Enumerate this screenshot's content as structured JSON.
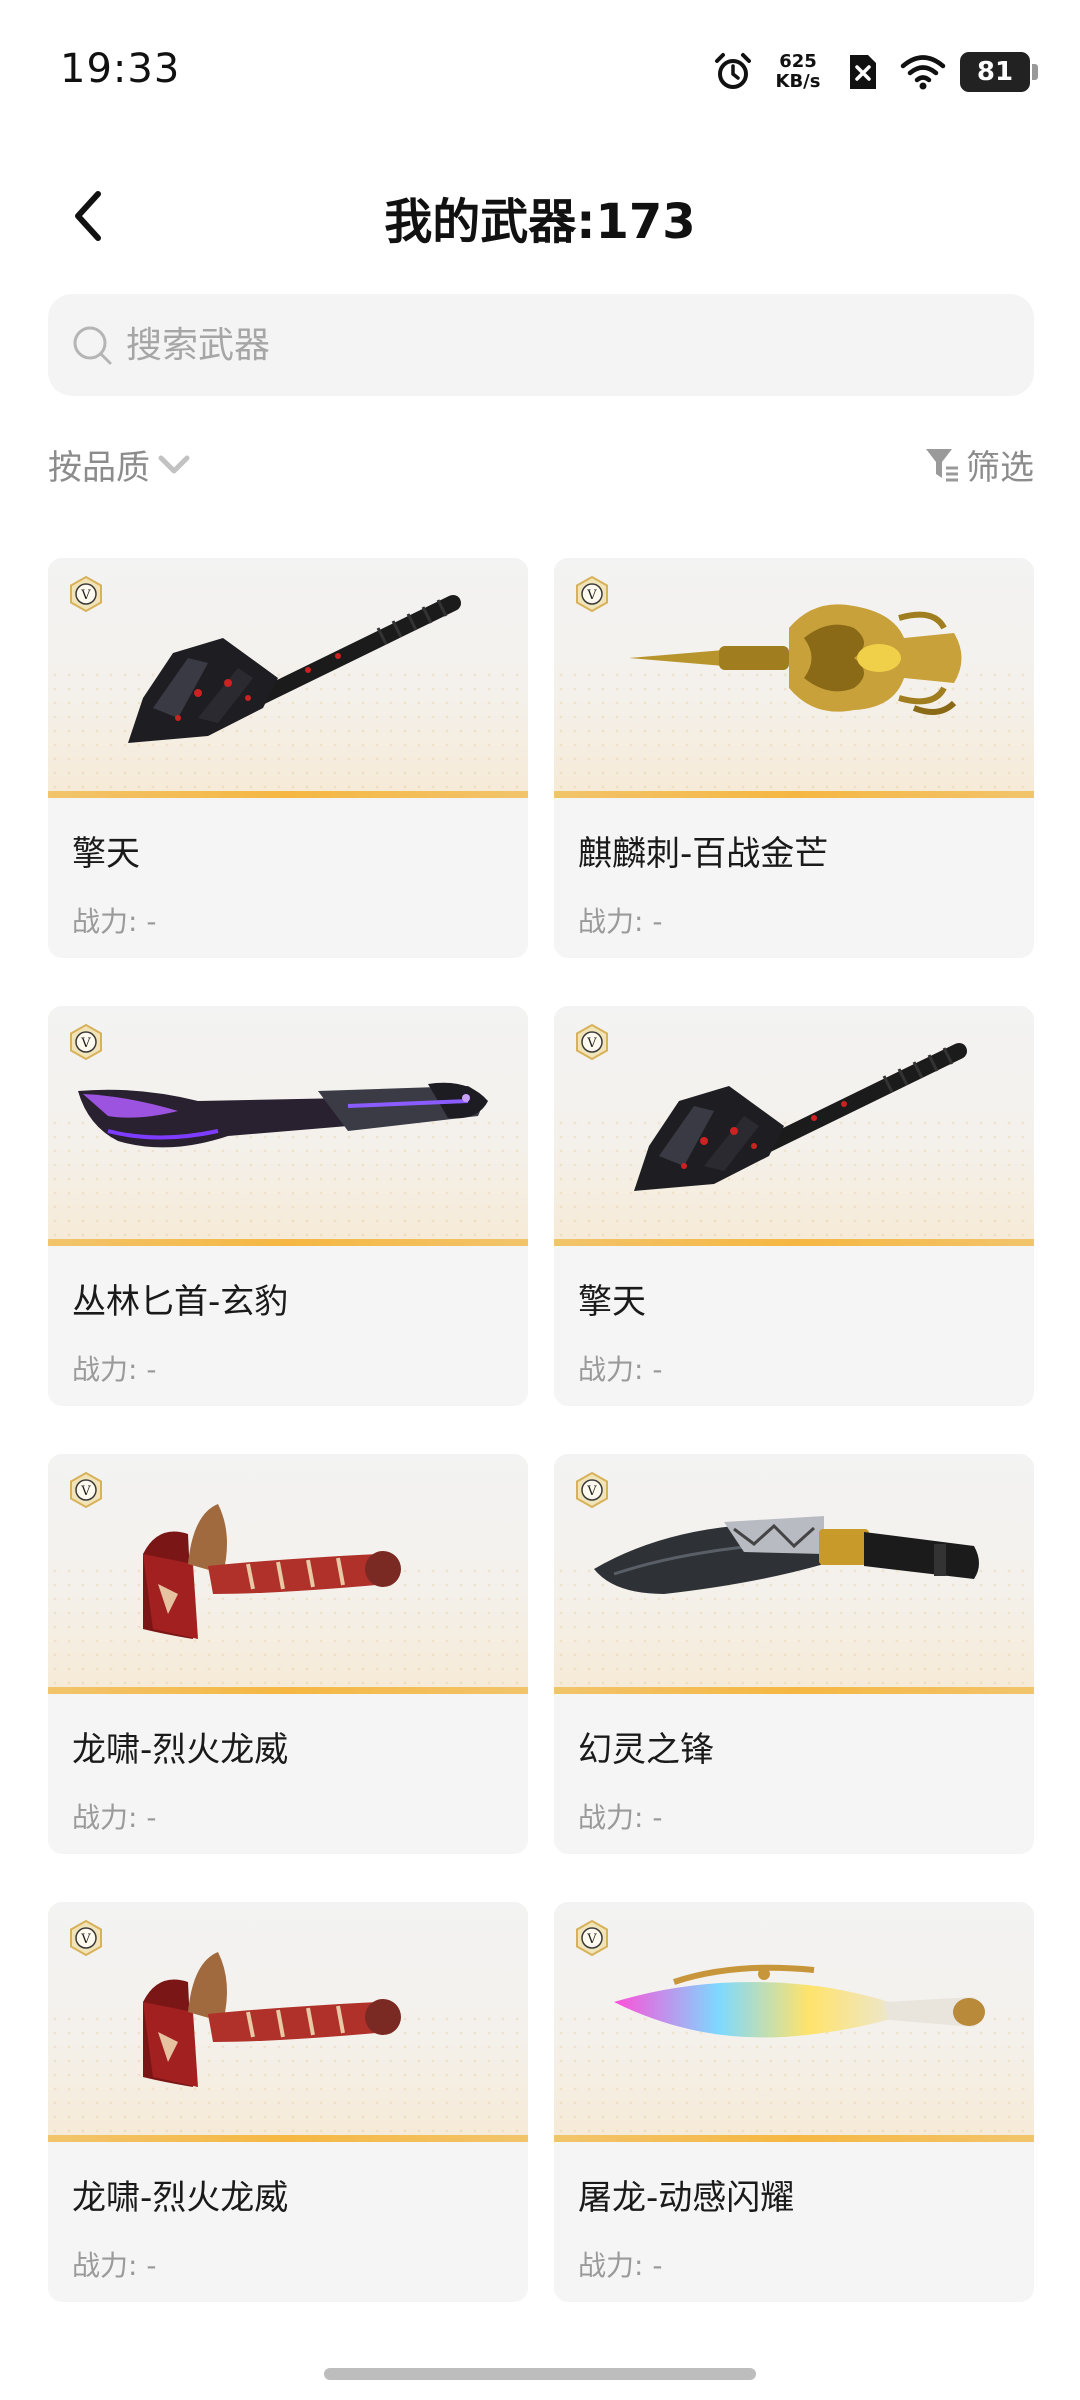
{
  "status_bar": {
    "time": "19:33",
    "net_speed_value": "625",
    "net_speed_unit": "KB/s",
    "battery": "81",
    "icons": [
      "alarm-icon",
      "no-sim-icon",
      "wifi-icon",
      "battery-icon"
    ]
  },
  "header": {
    "title": "我的武器:173",
    "back_icon": "chevron-left-icon"
  },
  "search": {
    "placeholder": "搜索武器",
    "value": ""
  },
  "sort": {
    "label": "按品质",
    "icon": "chevron-down-icon"
  },
  "filter": {
    "label": "筛选",
    "icon": "filter-icon"
  },
  "badge_letter": "V",
  "power_label": "战力: -",
  "weapons": [
    {
      "name": "擎天",
      "power": "战力: -",
      "kind": "spade"
    },
    {
      "name": "麒麟刺-百战金芒",
      "power": "战力: -",
      "kind": "golden-dagger"
    },
    {
      "name": "丛林匕首-玄豹",
      "power": "战力: -",
      "kind": "panther-knife"
    },
    {
      "name": "擎天",
      "power": "战力: -",
      "kind": "spade"
    },
    {
      "name": "龙啸-烈火龙威",
      "power": "战力: -",
      "kind": "dragon-axe"
    },
    {
      "name": "幻灵之锋",
      "power": "战力: -",
      "kind": "kukri"
    },
    {
      "name": "龙啸-烈火龙威",
      "power": "战力: -",
      "kind": "dragon-axe"
    },
    {
      "name": "屠龙-动感闪耀",
      "power": "战力: -",
      "kind": "rainbow-blade"
    }
  ],
  "colors": {
    "accent_bar": "#f5b742",
    "card_bg": "#f5f5f5",
    "badge_gold": "#d8b25a"
  }
}
